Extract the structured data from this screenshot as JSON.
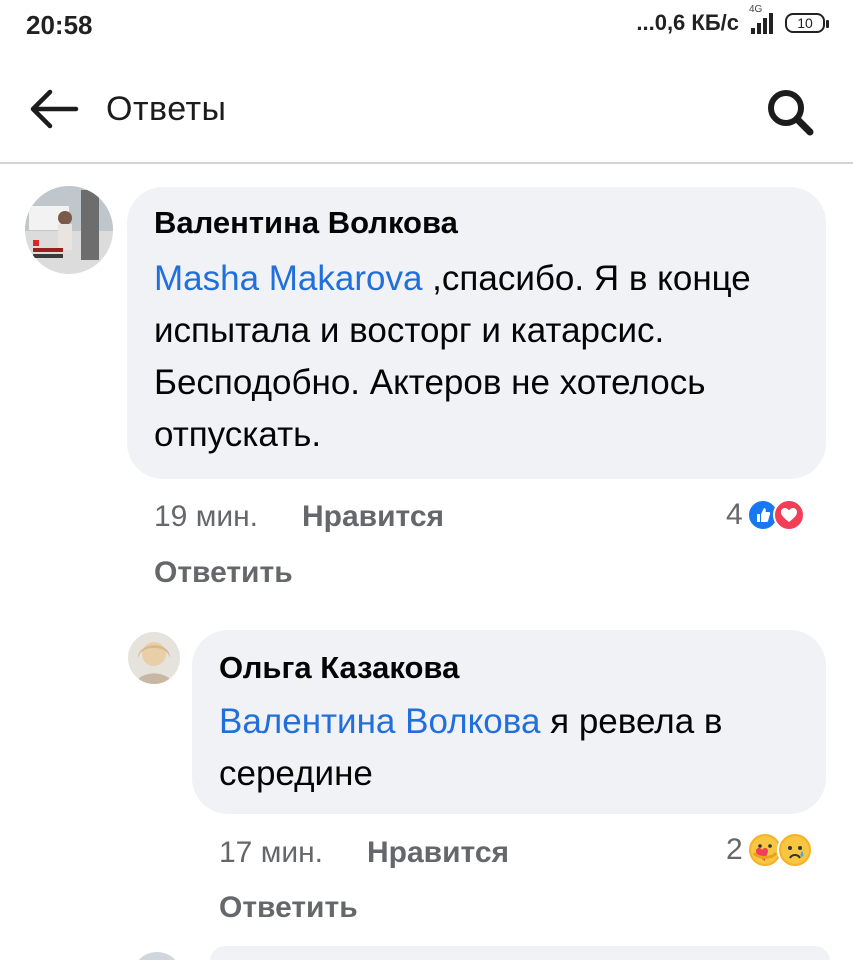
{
  "status_bar": {
    "time": "20:58",
    "net_speed": "...0,6 КБ/с",
    "network_type": "4G",
    "battery": "10"
  },
  "header": {
    "back_icon": "arrow-left-icon",
    "title": "Ответы",
    "search_icon": "search-icon"
  },
  "comments": [
    {
      "author": "Валентина Волкова",
      "mention": "Masha Makarova",
      "text": " ,спасибо. Я в конце испытала и восторг и катарсис. Бесподобно. Актеров не хотелось отпускать.",
      "time": "19 мин.",
      "like_label": "Нравится",
      "reply_label": "Ответить",
      "reaction_count": "4",
      "reactions": [
        "like-reaction-icon",
        "love-reaction-icon"
      ]
    },
    {
      "author": "Ольга Казакова",
      "mention": "Валентина Волкова",
      "text": " я ревела в середине",
      "time": "17 мин.",
      "like_label": "Нравится",
      "reply_label": "Ответить",
      "reaction_count": "2",
      "reactions": [
        "care-reaction-icon",
        "sad-reaction-icon"
      ]
    }
  ],
  "colors": {
    "mention": "#216fdb",
    "bubble": "#f0f2f5",
    "meta_text": "#65676b",
    "like_blue": "#1877f2",
    "love_red": "#f33e58"
  }
}
